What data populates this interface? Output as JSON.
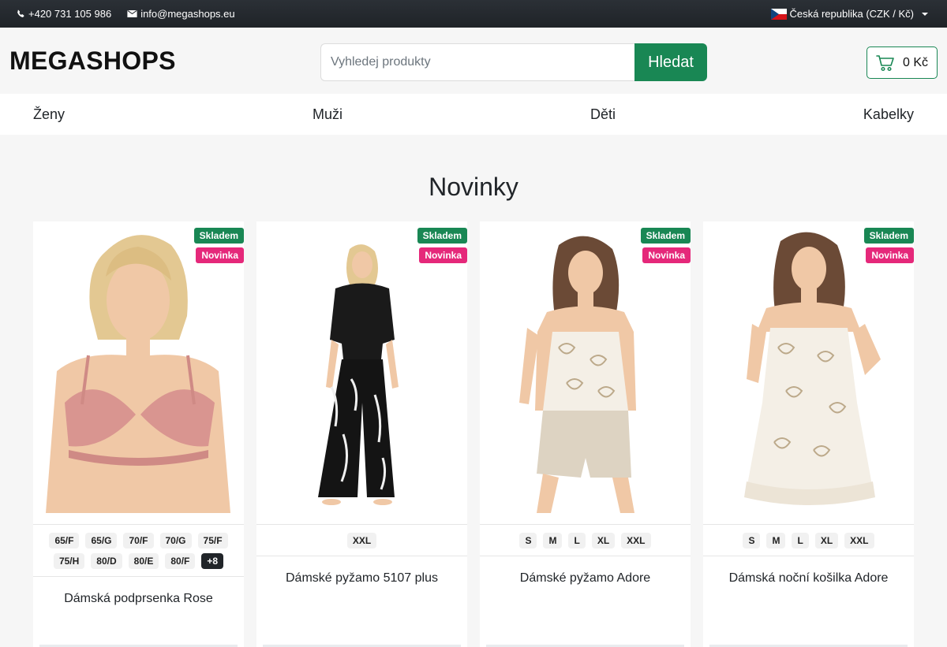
{
  "topbar": {
    "phone": "+420 731 105 986",
    "email": "info@megashops.eu",
    "region": "Česká republika (CZK / Kč)",
    "phone_icon": "phone-icon",
    "email_icon": "envelope-icon"
  },
  "header": {
    "logo": "MEGASHOPS",
    "search_placeholder": "Vyhledej produkty",
    "search_button": "Hledat",
    "cart_total": "0 Kč",
    "cart_icon": "cart-icon"
  },
  "nav": {
    "items": [
      "Ženy",
      "Muži",
      "Děti",
      "Kabelky"
    ]
  },
  "section": {
    "title": "Novinky"
  },
  "products": [
    {
      "badge_stock": "Skladem",
      "badge_new": "Novinka",
      "sizes": [
        "65/F",
        "65/G",
        "70/F",
        "70/G",
        "75/F",
        "75/H",
        "80/D",
        "80/E",
        "80/F"
      ],
      "more": "+8",
      "name": "Dámská podprsenka Rose"
    },
    {
      "badge_stock": "Skladem",
      "badge_new": "Novinka",
      "sizes": [
        "XXL"
      ],
      "name": "Dámské pyžamo 5107 plus"
    },
    {
      "badge_stock": "Skladem",
      "badge_new": "Novinka",
      "sizes": [
        "S",
        "M",
        "L",
        "XL",
        "XXL"
      ],
      "name": "Dámské pyžamo Adore"
    },
    {
      "badge_stock": "Skladem",
      "badge_new": "Novinka",
      "sizes": [
        "S",
        "M",
        "L",
        "XL",
        "XXL"
      ],
      "name": "Dámská noční košilka Adore"
    }
  ],
  "colors": {
    "accent_green": "#198754",
    "badge_pink": "#e5287a",
    "topbar": "#23272c"
  }
}
